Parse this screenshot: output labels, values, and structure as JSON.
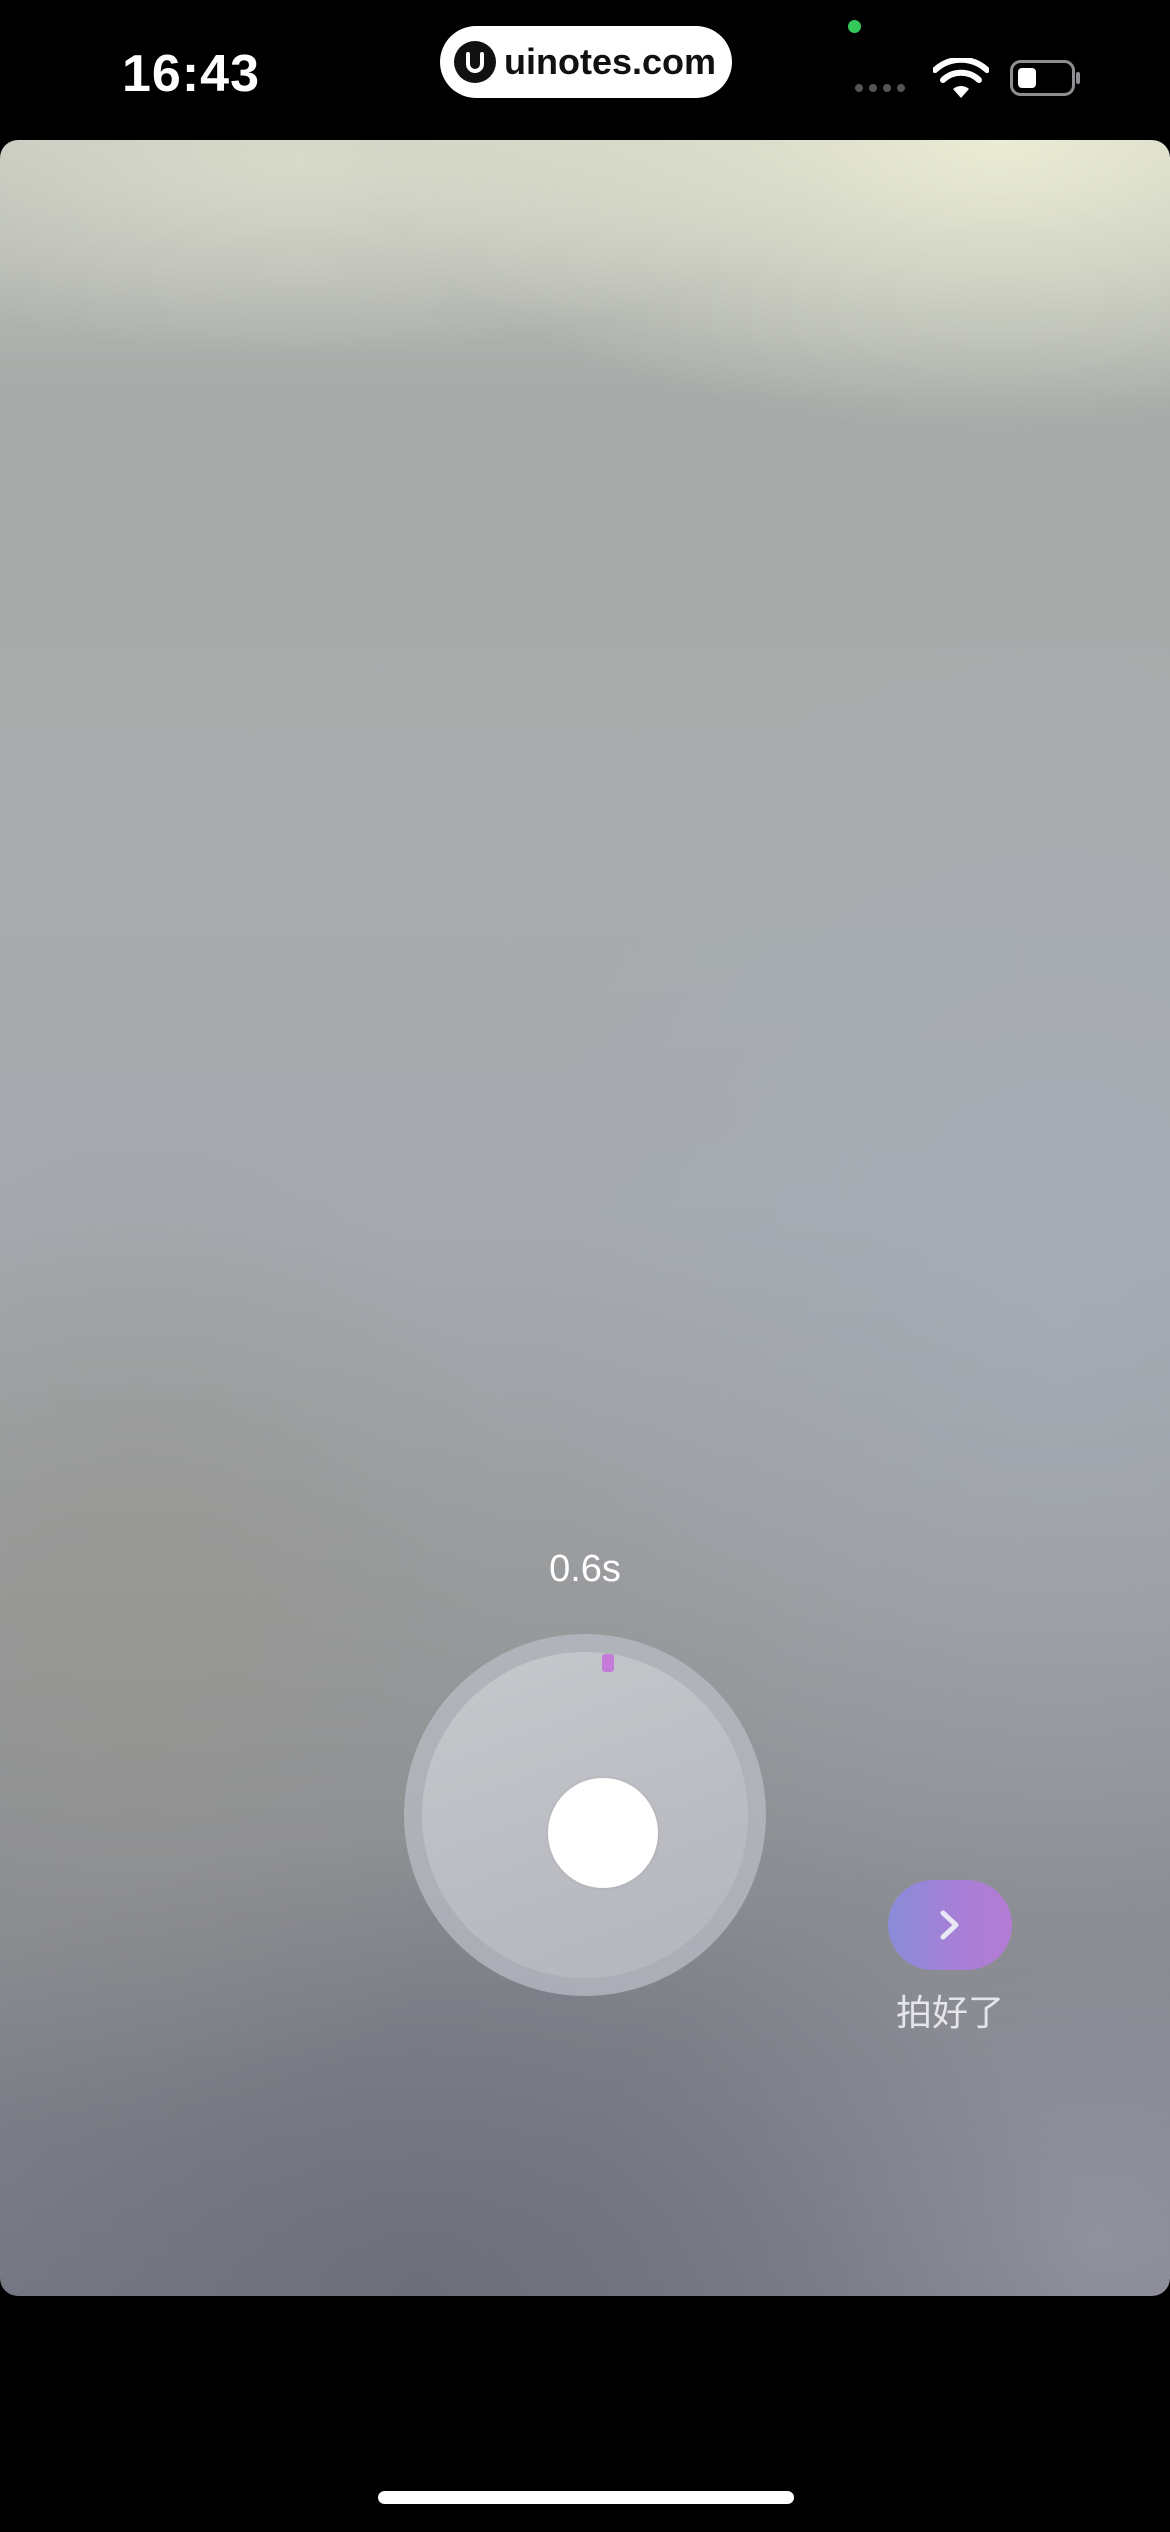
{
  "status_bar": {
    "time": "16:43",
    "watermark": "uinotes.com",
    "icons": [
      "signal-icon",
      "wifi-icon",
      "battery-icon"
    ],
    "battery_level": 0.3
  },
  "recorder": {
    "elapsed": "0.6s",
    "progress_color": "#c47cd8",
    "record_icon": "record-dot-icon"
  },
  "done": {
    "label": "拍好了",
    "icon": "chevron-right-icon",
    "gradient_colors": [
      "#8a8cd8",
      "#b47cd4"
    ]
  }
}
